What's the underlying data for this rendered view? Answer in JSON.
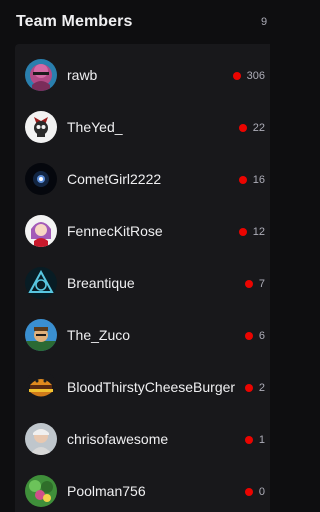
{
  "header": {
    "title": "Team Members",
    "count": "9"
  },
  "members": [
    {
      "name": "rawb",
      "viewers": "306",
      "avatar": "rawb-avatar-icon"
    },
    {
      "name": "TheYed_",
      "viewers": "22",
      "avatar": "skull-avatar-icon"
    },
    {
      "name": "CometGirl2222",
      "viewers": "16",
      "avatar": "comet-avatar-icon"
    },
    {
      "name": "FennecKitRose",
      "viewers": "12",
      "avatar": "anime-girl-avatar-icon"
    },
    {
      "name": "Breantique",
      "viewers": "7",
      "avatar": "triquetra-avatar-icon"
    },
    {
      "name": "The_Zuco",
      "viewers": "6",
      "avatar": "character-avatar-icon"
    },
    {
      "name": "BloodThirstyCheeseBurger",
      "viewers": "2",
      "avatar": "burger-avatar-icon"
    },
    {
      "name": "chrisofawesome",
      "viewers": "1",
      "avatar": "person-avatar-icon"
    },
    {
      "name": "Poolman756",
      "viewers": "0",
      "avatar": "garden-avatar-icon"
    }
  ],
  "colors": {
    "background": "#0e0e10",
    "panel": "#18181b",
    "live": "#eb0400",
    "text": "#efeff1",
    "muted": "#adadb8"
  }
}
